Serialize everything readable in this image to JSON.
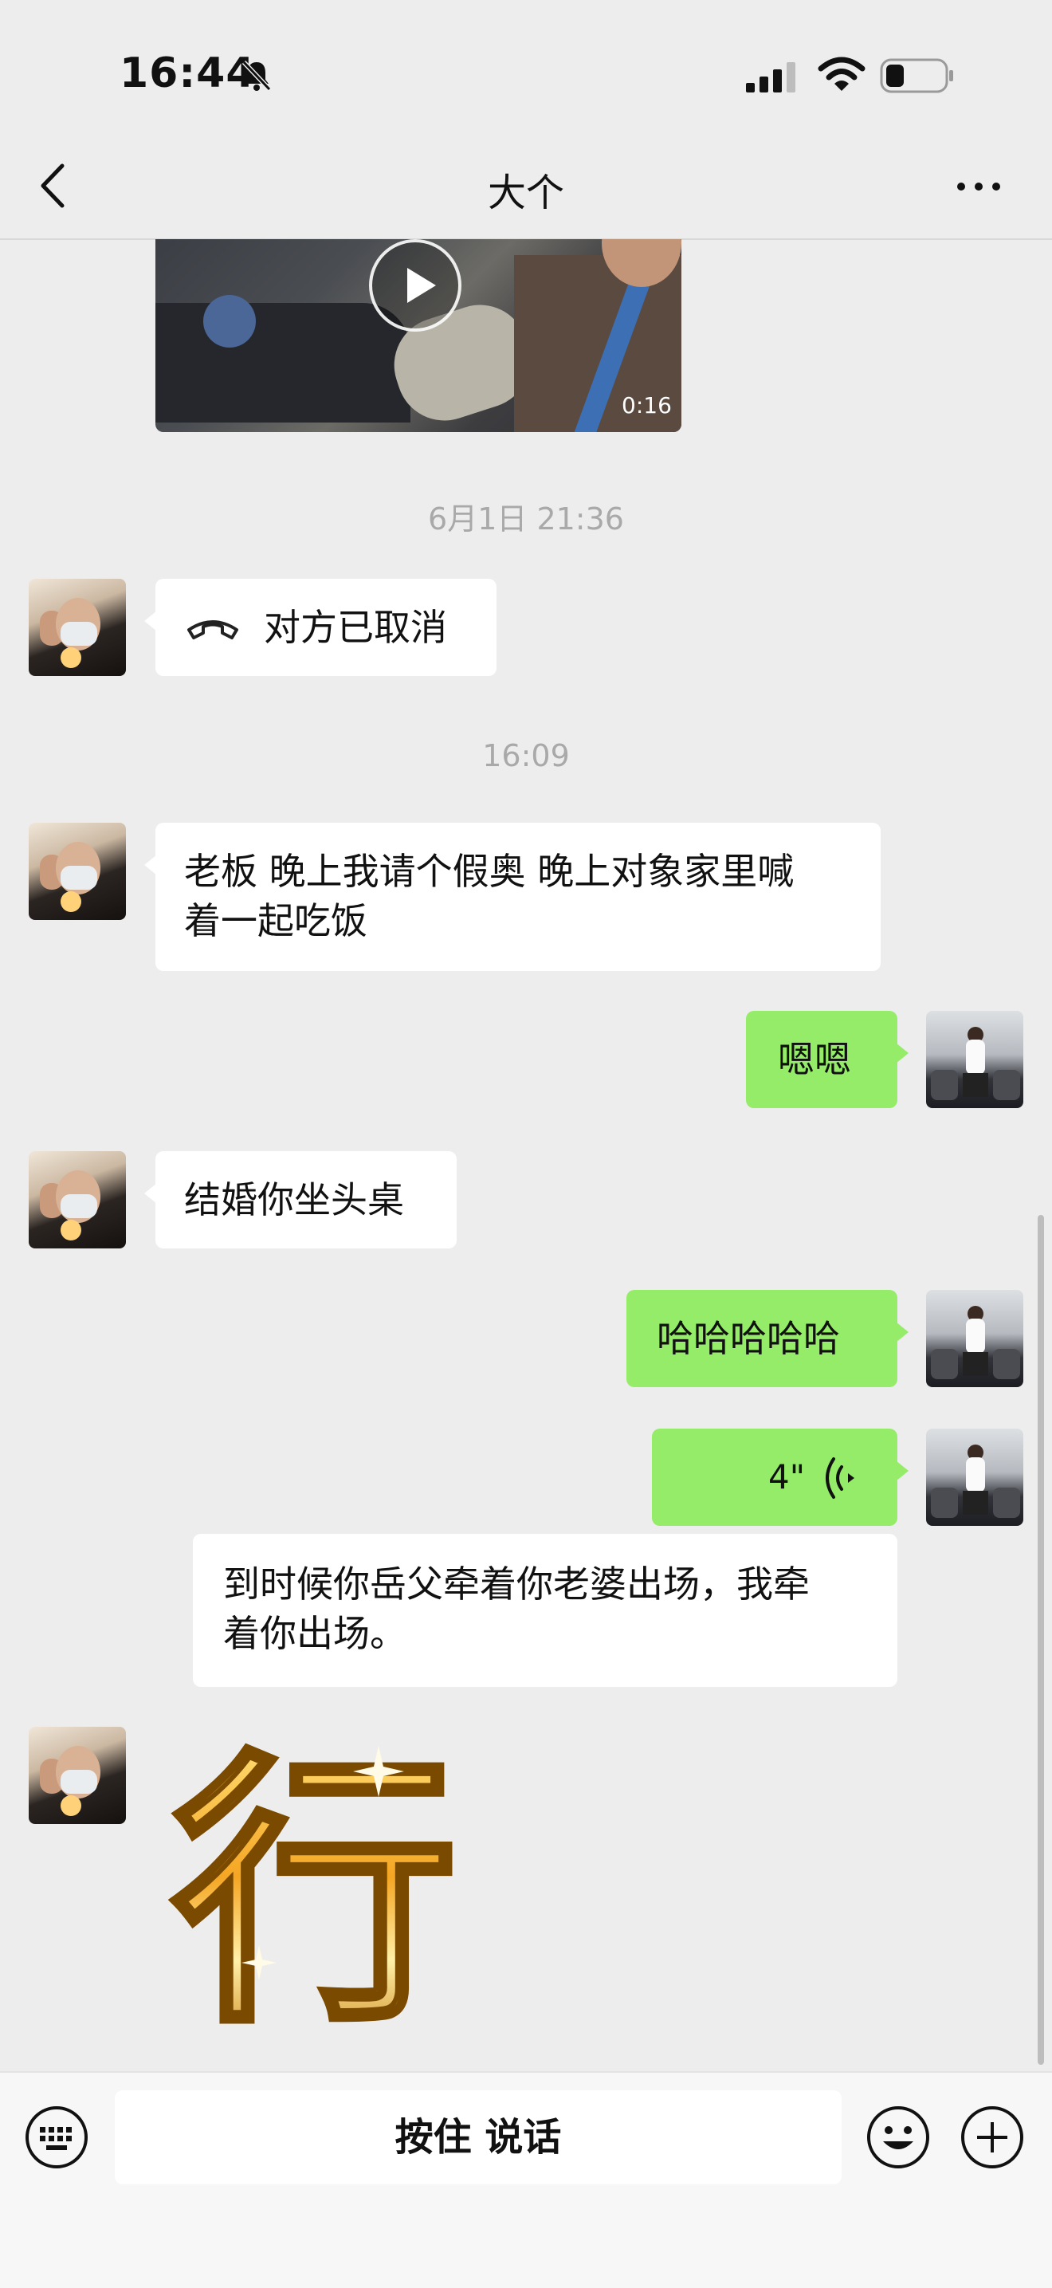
{
  "status_bar": {
    "time": "16:44",
    "icons": [
      "bell-muted-icon",
      "signal-icon",
      "wifi-icon",
      "battery-icon"
    ]
  },
  "nav": {
    "title": "大个",
    "back_icon": "chevron-left-icon",
    "more_icon": "ellipsis-icon"
  },
  "video": {
    "duration": "0:16",
    "icon": "play-icon"
  },
  "messages": [
    {
      "type": "timestamp",
      "text": "6月1日 21:36"
    },
    {
      "type": "call",
      "from": "them",
      "text": "对方已取消",
      "icon": "phone-hangup-icon"
    },
    {
      "type": "timestamp",
      "text": "16:09"
    },
    {
      "type": "text",
      "from": "them",
      "text": "老板 晚上我请个假奥 晚上对象家里喊着一起吃饭",
      "line1": "老板 晚上我请个假奥 晚上对象家里喊",
      "line2": "着一起吃饭"
    },
    {
      "type": "text",
      "from": "me",
      "text": "嗯嗯"
    },
    {
      "type": "text",
      "from": "them",
      "text": "结婚你坐头桌"
    },
    {
      "type": "text",
      "from": "me",
      "text": "哈哈哈哈哈"
    },
    {
      "type": "voice",
      "from": "me",
      "length": "4\"",
      "icon": "voice-wave-icon"
    },
    {
      "type": "quote",
      "from": "me",
      "text": "到时候你岳父牵着你老婆出场，我牵着你出场。",
      "line1": "到时候你岳父牵着你老婆出场，我牵",
      "line2": "着你出场。"
    },
    {
      "type": "sticker",
      "from": "them",
      "text": "行"
    }
  ],
  "input_bar": {
    "hold_to_talk": "按住 说话",
    "icons": [
      "keyboard-icon",
      "emoji-icon",
      "plus-icon"
    ]
  },
  "colors": {
    "background": "#ededed",
    "bubble_green": "#95ec69",
    "bubble_white": "#ffffff",
    "timestamp": "#a9a9a9"
  }
}
